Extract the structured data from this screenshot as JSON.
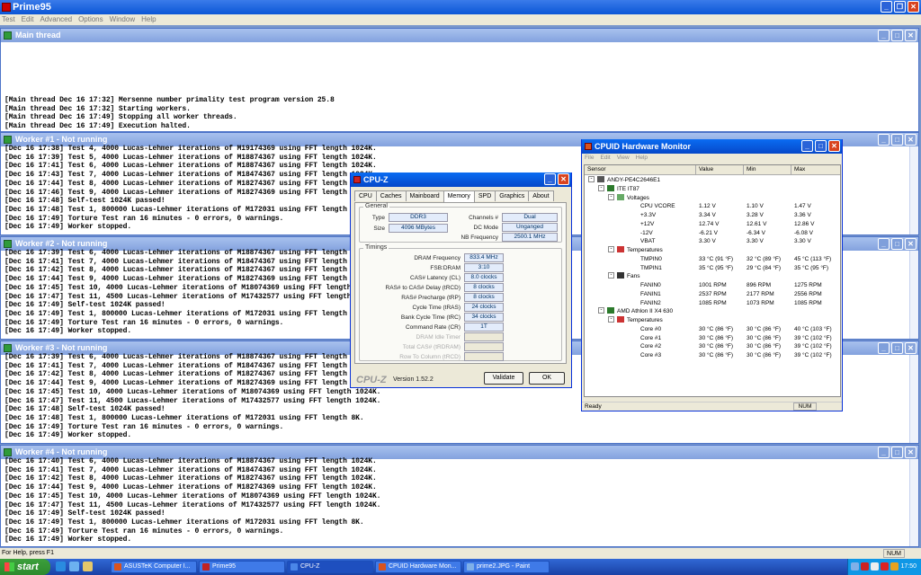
{
  "app": {
    "title": "Prime95"
  },
  "menu": [
    "Test",
    "Edit",
    "Advanced",
    "Options",
    "Window",
    "Help"
  ],
  "windows": [
    {
      "title": "Main thread",
      "lines": [
        "[Main thread Dec 16 17:32] Mersenne number primality test program version 25.8",
        "[Main thread Dec 16 17:32] Starting workers.",
        "[Main thread Dec 16 17:49] Stopping all worker threads.",
        "[Main thread Dec 16 17:49] Execution halted."
      ]
    },
    {
      "title": "Worker #1 - Not running",
      "lines": [
        "[Dec 16 17:38] Test 4, 4000 Lucas-Lehmer iterations of M19174369 using FFT length 1024K.",
        "[Dec 16 17:39] Test 5, 4000 Lucas-Lehmer iterations of M18874367 using FFT length 1024K.",
        "[Dec 16 17:41] Test 6, 4000 Lucas-Lehmer iterations of M18874367 using FFT length 1024K.",
        "[Dec 16 17:43] Test 7, 4000 Lucas-Lehmer iterations of M18474367 using FFT length 1024K.",
        "[Dec 16 17:44] Test 8, 4000 Lucas-Lehmer iterations of M18274367 using FFT length 1024K.",
        "[Dec 16 17:46] Test 9, 4000 Lucas-Lehmer iterations of M18274369 using FFT length 1024K.",
        "[Dec 16 17:48] Self-test 1024K passed!",
        "[Dec 16 17:48] Test 1, 800000 Lucas-Lehmer iterations of M172031 using FFT length 8K.",
        "[Dec 16 17:49] Torture Test ran 16 minutes - 0 errors, 0 warnings.",
        "[Dec 16 17:49] Worker stopped."
      ]
    },
    {
      "title": "Worker #2 - Not running",
      "lines": [
        "[Dec 16 17:39] Test 6, 4000 Lucas-Lehmer iterations of M18874367 using FFT length 1024K.",
        "[Dec 16 17:41] Test 7, 4000 Lucas-Lehmer iterations of M18474367 using FFT length 1024K.",
        "[Dec 16 17:42] Test 8, 4000 Lucas-Lehmer iterations of M18274367 using FFT length 1024K.",
        "[Dec 16 17:44] Test 9, 4000 Lucas-Lehmer iterations of M18274369 using FFT length 1024K.",
        "[Dec 16 17:45] Test 10, 4000 Lucas-Lehmer iterations of M18074369 using FFT length 1024K.",
        "[Dec 16 17:47] Test 11, 4500 Lucas-Lehmer iterations of M17432577 using FFT length 1024K.",
        "[Dec 16 17:49] Self-test 1024K passed!",
        "[Dec 16 17:49] Test 1, 800000 Lucas-Lehmer iterations of M172031 using FFT length 8K.",
        "[Dec 16 17:49] Torture Test ran 16 minutes - 0 errors, 0 warnings.",
        "[Dec 16 17:49] Worker stopped."
      ]
    },
    {
      "title": "Worker #3 - Not running",
      "lines": [
        "[Dec 16 17:39] Test 6, 4000 Lucas-Lehmer iterations of M18874367 using FFT length 1024K.",
        "[Dec 16 17:41] Test 7, 4000 Lucas-Lehmer iterations of M18474367 using FFT length 1024K.",
        "[Dec 16 17:42] Test 8, 4000 Lucas-Lehmer iterations of M18274367 using FFT length 1024K.",
        "[Dec 16 17:44] Test 9, 4000 Lucas-Lehmer iterations of M18274369 using FFT length 1024K.",
        "[Dec 16 17:45] Test 10, 4000 Lucas-Lehmer iterations of M18074369 using FFT length 1024K.",
        "[Dec 16 17:47] Test 11, 4500 Lucas-Lehmer iterations of M17432577 using FFT length 1024K.",
        "[Dec 16 17:48] Self-test 1024K passed!",
        "[Dec 16 17:48] Test 1, 800000 Lucas-Lehmer iterations of M172031 using FFT length 8K.",
        "[Dec 16 17:49] Torture Test ran 16 minutes - 0 errors, 0 warnings.",
        "[Dec 16 17:49] Worker stopped."
      ]
    },
    {
      "title": "Worker #4 - Not running",
      "lines": [
        "[Dec 16 17:40] Test 6, 4000 Lucas-Lehmer iterations of M18874367 using FFT length 1024K.",
        "[Dec 16 17:41] Test 7, 4000 Lucas-Lehmer iterations of M18474367 using FFT length 1024K.",
        "[Dec 16 17:42] Test 8, 4000 Lucas-Lehmer iterations of M18274367 using FFT length 1024K.",
        "[Dec 16 17:44] Test 9, 4000 Lucas-Lehmer iterations of M18274369 using FFT length 1024K.",
        "[Dec 16 17:45] Test 10, 4000 Lucas-Lehmer iterations of M18074369 using FFT length 1024K.",
        "[Dec 16 17:47] Test 11, 4500 Lucas-Lehmer iterations of M17432577 using FFT length 1024K.",
        "[Dec 16 17:49] Self-test 1024K passed!",
        "[Dec 16 17:49] Test 1, 800000 Lucas-Lehmer iterations of M172031 using FFT length 8K.",
        "[Dec 16 17:49] Torture Test ran 16 minutes - 0 errors, 0 warnings.",
        "[Dec 16 17:49] Worker stopped."
      ]
    }
  ],
  "status": {
    "text": "For Help, press F1",
    "num": "NUM"
  },
  "cpuz": {
    "title": "CPU-Z",
    "tabs": [
      "CPU",
      "Caches",
      "Mainboard",
      "Memory",
      "SPD",
      "Graphics",
      "About"
    ],
    "active_tab": "Memory",
    "general_label": "General",
    "type_label": "Type",
    "type": "DDR3",
    "size_label": "Size",
    "size": "4096 MBytes",
    "channels_label": "Channels #",
    "channels": "Dual",
    "dcmode_label": "DC Mode",
    "dcmode": "Unganged",
    "nbfreq_label": "NB Frequency",
    "nbfreq": "2500.1 MHz",
    "timings_label": "Timings",
    "timings": [
      {
        "label": "DRAM Frequency",
        "value": "833.4 MHz"
      },
      {
        "label": "FSB:DRAM",
        "value": "3:10"
      },
      {
        "label": "CAS# Latency (CL)",
        "value": "8.0 clocks"
      },
      {
        "label": "RAS# to CAS# Delay (tRCD)",
        "value": "8 clocks"
      },
      {
        "label": "RAS# Precharge (tRP)",
        "value": "8 clocks"
      },
      {
        "label": "Cycle Time (tRAS)",
        "value": "24 clocks"
      },
      {
        "label": "Bank Cycle Time (tRC)",
        "value": "34 clocks"
      },
      {
        "label": "Command Rate (CR)",
        "value": "1T"
      },
      {
        "label": "DRAM Idle Timer",
        "value": ""
      },
      {
        "label": "Total CAS# (tRDRAM)",
        "value": ""
      },
      {
        "label": "Row To Column (tRCD)",
        "value": ""
      }
    ],
    "logo": "CPU-Z",
    "version": "Version 1.52.2",
    "validate": "Validate",
    "ok": "OK"
  },
  "hwmon": {
    "title": "CPUID Hardware Monitor",
    "menu": [
      "File",
      "Edit",
      "View",
      "Help"
    ],
    "columns": [
      "Sensor",
      "Value",
      "Min",
      "Max"
    ],
    "rows": [
      {
        "level": 0,
        "node": "-",
        "icon": "computer-icon",
        "name": "ANDY-PE4C2646E1",
        "value": "",
        "min": "",
        "max": ""
      },
      {
        "level": 1,
        "node": "-",
        "icon": "chip-icon",
        "name": "ITE IT87",
        "value": "",
        "min": "",
        "max": ""
      },
      {
        "level": 2,
        "node": "-",
        "icon": "voltage-icon",
        "name": "Voltages",
        "value": "",
        "min": "",
        "max": ""
      },
      {
        "level": 3,
        "node": "",
        "icon": "",
        "name": "CPU VCORE",
        "value": "1.12 V",
        "min": "1.10 V",
        "max": "1.47 V"
      },
      {
        "level": 3,
        "node": "",
        "icon": "",
        "name": "+3.3V",
        "value": "3.34 V",
        "min": "3.28 V",
        "max": "3.36 V"
      },
      {
        "level": 3,
        "node": "",
        "icon": "",
        "name": "+12V",
        "value": "12.74 V",
        "min": "12.61 V",
        "max": "12.86 V"
      },
      {
        "level": 3,
        "node": "",
        "icon": "",
        "name": "-12V",
        "value": "-6.21 V",
        "min": "-6.34 V",
        "max": "-6.08 V"
      },
      {
        "level": 3,
        "node": "",
        "icon": "",
        "name": "VBAT",
        "value": "3.30 V",
        "min": "3.30 V",
        "max": "3.30 V"
      },
      {
        "level": 2,
        "node": "-",
        "icon": "thermometer-icon",
        "name": "Temperatures",
        "value": "",
        "min": "",
        "max": ""
      },
      {
        "level": 3,
        "node": "",
        "icon": "",
        "name": "TMPIN0",
        "value": "33 °C (91 °F)",
        "min": "32 °C (89 °F)",
        "max": "45 °C (113 °F)"
      },
      {
        "level": 3,
        "node": "",
        "icon": "",
        "name": "TMPIN1",
        "value": "35 °C (95 °F)",
        "min": "29 °C (84 °F)",
        "max": "35 °C (95 °F)"
      },
      {
        "level": 2,
        "node": "-",
        "icon": "fan-icon",
        "name": "Fans",
        "value": "",
        "min": "",
        "max": ""
      },
      {
        "level": 3,
        "node": "",
        "icon": "",
        "name": "FANIN0",
        "value": "1001 RPM",
        "min": "896 RPM",
        "max": "1275 RPM"
      },
      {
        "level": 3,
        "node": "",
        "icon": "",
        "name": "FANIN1",
        "value": "2537 RPM",
        "min": "2177 RPM",
        "max": "2556 RPM"
      },
      {
        "level": 3,
        "node": "",
        "icon": "",
        "name": "FANIN2",
        "value": "1085 RPM",
        "min": "1073 RPM",
        "max": "1085 RPM"
      },
      {
        "level": 1,
        "node": "-",
        "icon": "chip-icon",
        "name": "AMD Athlon II X4 630",
        "value": "",
        "min": "",
        "max": ""
      },
      {
        "level": 2,
        "node": "-",
        "icon": "thermometer-icon",
        "name": "Temperatures",
        "value": "",
        "min": "",
        "max": ""
      },
      {
        "level": 3,
        "node": "",
        "icon": "",
        "name": "Core #0",
        "value": "30 °C (86 °F)",
        "min": "30 °C (86 °F)",
        "max": "40 °C (103 °F)"
      },
      {
        "level": 3,
        "node": "",
        "icon": "",
        "name": "Core #1",
        "value": "30 °C (86 °F)",
        "min": "30 °C (86 °F)",
        "max": "39 °C (102 °F)"
      },
      {
        "level": 3,
        "node": "",
        "icon": "",
        "name": "Core #2",
        "value": "30 °C (86 °F)",
        "min": "30 °C (86 °F)",
        "max": "39 °C (102 °F)"
      },
      {
        "level": 3,
        "node": "",
        "icon": "",
        "name": "Core #3",
        "value": "30 °C (86 °F)",
        "min": "30 °C (86 °F)",
        "max": "39 °C (102 °F)"
      }
    ],
    "status": "Ready",
    "num": "NUM"
  },
  "taskbar": {
    "start": "start",
    "tasks": [
      {
        "label": "ASUSTeK Computer I...",
        "icon_color": "#d9531e"
      },
      {
        "label": "Prime95",
        "icon_color": "#c22222"
      },
      {
        "label": "CPU-Z",
        "icon_color": "#4a86e8"
      },
      {
        "label": "CPUID Hardware Mon...",
        "icon_color": "#d9531e"
      },
      {
        "label": "prime2.JPG - Paint",
        "icon_color": "#7fb0e8"
      }
    ],
    "clock": "17:50"
  }
}
